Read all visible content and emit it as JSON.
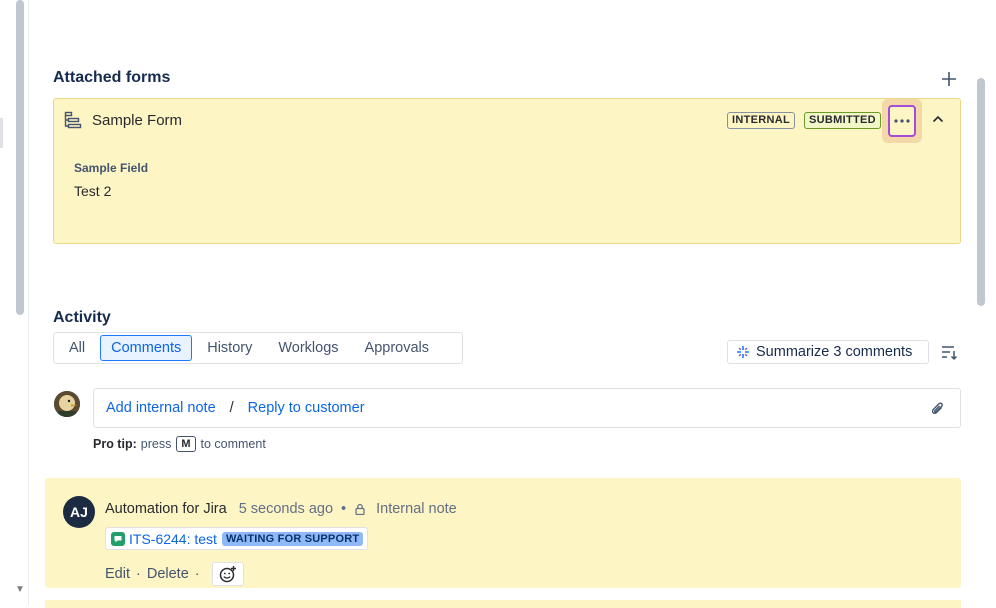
{
  "attached_forms": {
    "title": "Attached forms",
    "add_icon": "plus-icon",
    "form": {
      "icon": "form-icon",
      "name": "Sample Form",
      "badges": [
        "INTERNAL",
        "SUBMITTED"
      ],
      "more_label": "···",
      "collapse_icon": "chevron-up-icon",
      "field_label": "Sample Field",
      "field_value": "Test 2"
    }
  },
  "activity": {
    "title": "Activity",
    "tabs": [
      "All",
      "Comments",
      "History",
      "Worklogs",
      "Approvals"
    ],
    "active_tab": "Comments",
    "summarize_label": "Summarize 3 comments",
    "summarize_icon": "ai-sparkle-icon",
    "sort_icon": "sort-icon"
  },
  "composer": {
    "add_internal_note": "Add internal note",
    "separator": "/",
    "reply_to_customer": "Reply to customer",
    "attach_icon": "paperclip-icon",
    "pro_tip_label": "Pro tip:",
    "pro_tip_pre": "press",
    "pro_tip_key": "M",
    "pro_tip_post": "to comment"
  },
  "comment": {
    "avatar_initials": "AJ",
    "author": "Automation for Jira",
    "timestamp": "5 seconds ago",
    "bullet": "•",
    "visibility_icon": "lock-icon",
    "visibility": "Internal note",
    "issue_key_summary": "ITS-6244: test",
    "issue_status": "WAITING FOR SUPPORT",
    "edit_label": "Edit",
    "delete_label": "Delete",
    "action_sep": "·",
    "reaction_icon": "add-reaction-icon"
  },
  "colors": {
    "form_bg": "#fdf5c4",
    "link": "#0c66e4",
    "focus_ring": "#a54cd8",
    "status_lozenge": "#8fb8f6"
  }
}
